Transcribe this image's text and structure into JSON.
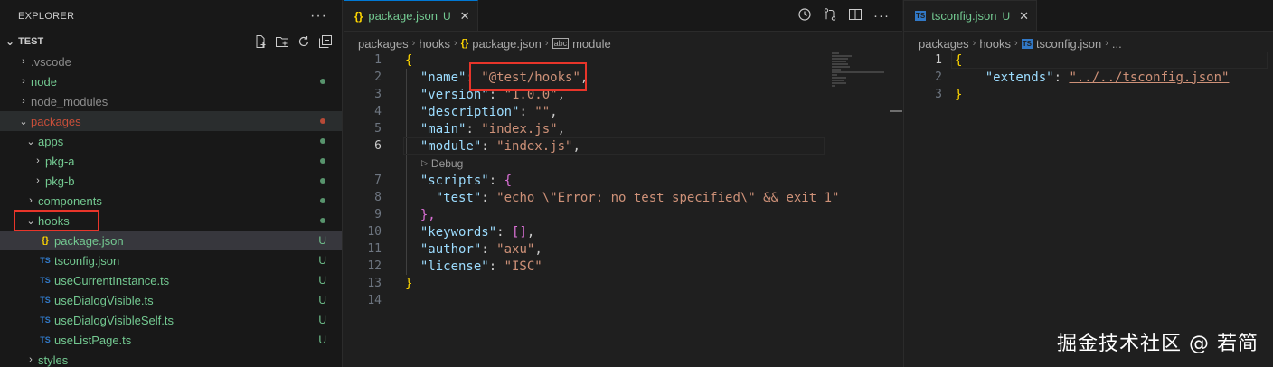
{
  "explorer": {
    "title": "EXPLORER",
    "more": "···",
    "root_label": "TEST",
    "items": [
      {
        "label": ".vscode",
        "chevron": "›",
        "icon": "",
        "depth": 0,
        "deco": "",
        "dot": ""
      },
      {
        "label": "node",
        "chevron": "›",
        "icon": "",
        "depth": 0,
        "deco": "",
        "dot": "green"
      },
      {
        "label": "node_modules",
        "chevron": "›",
        "icon": "",
        "depth": 0,
        "deco": "",
        "dot": ""
      },
      {
        "label": "packages",
        "chevron": "⌄",
        "icon": "",
        "depth": 0,
        "deco": "",
        "dot": "red"
      },
      {
        "label": "apps",
        "chevron": "⌄",
        "icon": "",
        "depth": 1,
        "deco": "",
        "dot": "green"
      },
      {
        "label": "pkg-a",
        "chevron": "›",
        "icon": "",
        "depth": 2,
        "deco": "",
        "dot": "green"
      },
      {
        "label": "pkg-b",
        "chevron": "›",
        "icon": "",
        "depth": 2,
        "deco": "",
        "dot": "green"
      },
      {
        "label": "components",
        "chevron": "›",
        "icon": "",
        "depth": 1,
        "deco": "",
        "dot": "green"
      },
      {
        "label": "hooks",
        "chevron": "⌄",
        "icon": "",
        "depth": 1,
        "deco": "",
        "dot": "green"
      },
      {
        "label": "package.json",
        "chevron": "",
        "icon": "{}",
        "depth": 2,
        "deco": "U",
        "dot": ""
      },
      {
        "label": "tsconfig.json",
        "chevron": "",
        "icon": "TS",
        "depth": 2,
        "deco": "U",
        "dot": ""
      },
      {
        "label": "useCurrentInstance.ts",
        "chevron": "",
        "icon": "TS",
        "depth": 2,
        "deco": "U",
        "dot": ""
      },
      {
        "label": "useDialogVisible.ts",
        "chevron": "",
        "icon": "TS",
        "depth": 2,
        "deco": "U",
        "dot": ""
      },
      {
        "label": "useDialogVisibleSelf.ts",
        "chevron": "",
        "icon": "TS",
        "depth": 2,
        "deco": "U",
        "dot": ""
      },
      {
        "label": "useListPage.ts",
        "chevron": "",
        "icon": "TS",
        "depth": 2,
        "deco": "U",
        "dot": ""
      },
      {
        "label": "styles",
        "chevron": "›",
        "icon": "",
        "depth": 1,
        "deco": "",
        "dot": ""
      }
    ]
  },
  "editor1": {
    "tab": {
      "icon": "{}",
      "label": "package.json",
      "status": "U",
      "close": "✕"
    },
    "breadcrumb": [
      "packages",
      "hooks",
      "package.json",
      "module"
    ],
    "breadcrumb_icons": [
      "{}",
      "abc"
    ],
    "codelens": "Debug",
    "lines": {
      "l1": "{",
      "l2_key": "\"name\"",
      "l2_val": "\"@test/hooks\"",
      "l3_key": "\"version\"",
      "l3_val": "\"1.0.0\"",
      "l4_key": "\"description\"",
      "l4_val": "\"\"",
      "l5_key": "\"main\"",
      "l5_val": "\"index.js\"",
      "l6_key": "\"module\"",
      "l6_val": "\"index.js\"",
      "l7_key": "\"scripts\"",
      "l7_val": "{",
      "l8_key": "\"test\"",
      "l8_val": "\"echo \\\"Error: no test specified\\\" && exit 1\"",
      "l9": "},",
      "l10_key": "\"keywords\"",
      "l10_val": "[]",
      "l11_key": "\"author\"",
      "l11_val": "\"axu\"",
      "l12_key": "\"license\"",
      "l12_val": "\"ISC\"",
      "l13": "}"
    },
    "line_numbers": [
      "1",
      "2",
      "3",
      "4",
      "5",
      "6",
      "7",
      "8",
      "9",
      "10",
      "11",
      "12",
      "13",
      "14"
    ]
  },
  "editor2": {
    "tab": {
      "icon": "TS",
      "label": "tsconfig.json",
      "status": "U",
      "close": "✕"
    },
    "breadcrumb": [
      "packages",
      "hooks",
      "tsconfig.json",
      "..."
    ],
    "breadcrumb_icons": [
      "TS"
    ],
    "lines": {
      "l1": "{",
      "l2_key": "\"extends\"",
      "l2_val": "\"../../tsconfig.json\"",
      "l3": "}"
    },
    "line_numbers": [
      "1",
      "2",
      "3"
    ]
  },
  "watermark": "掘金技术社区 @ 若简",
  "colors": {
    "accent": "#0078d4",
    "untracked": "#73c991",
    "modified_dot": "#c74e39",
    "highlight_box": "#e8352a"
  }
}
